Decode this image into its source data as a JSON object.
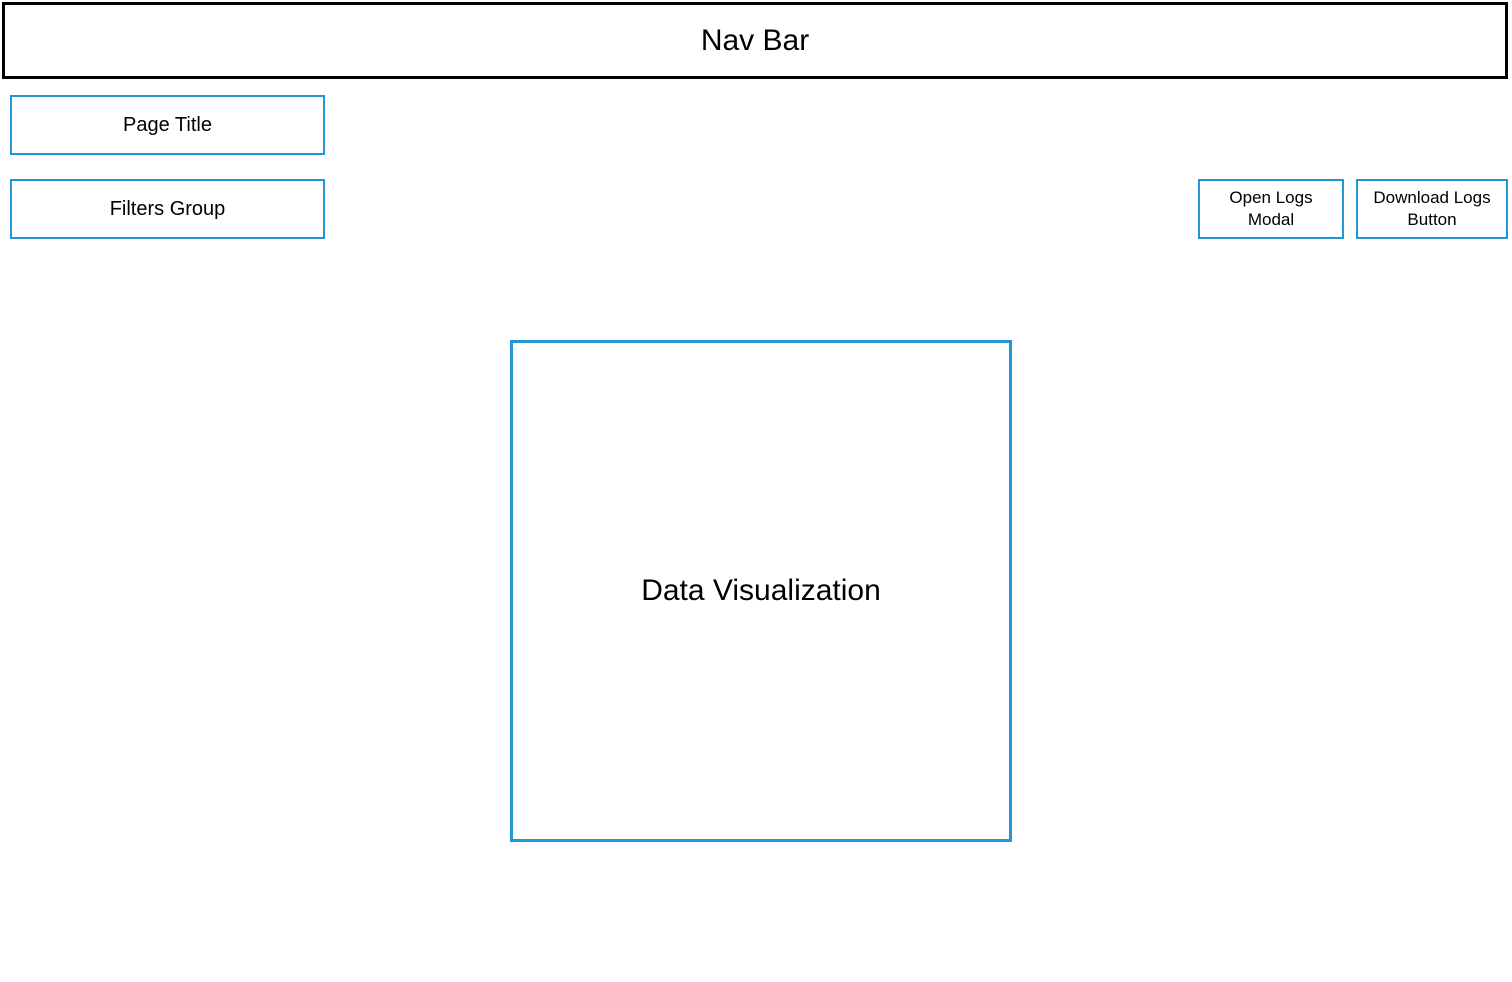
{
  "navBar": {
    "label": "Nav Bar"
  },
  "pageTitle": {
    "label": "Page Title"
  },
  "filtersGroup": {
    "label": "Filters Group"
  },
  "openLogsModal": {
    "label": "Open Logs Modal"
  },
  "downloadLogsButton": {
    "label": "Download Logs Button"
  },
  "dataVisualization": {
    "label": "Data Visualization"
  }
}
